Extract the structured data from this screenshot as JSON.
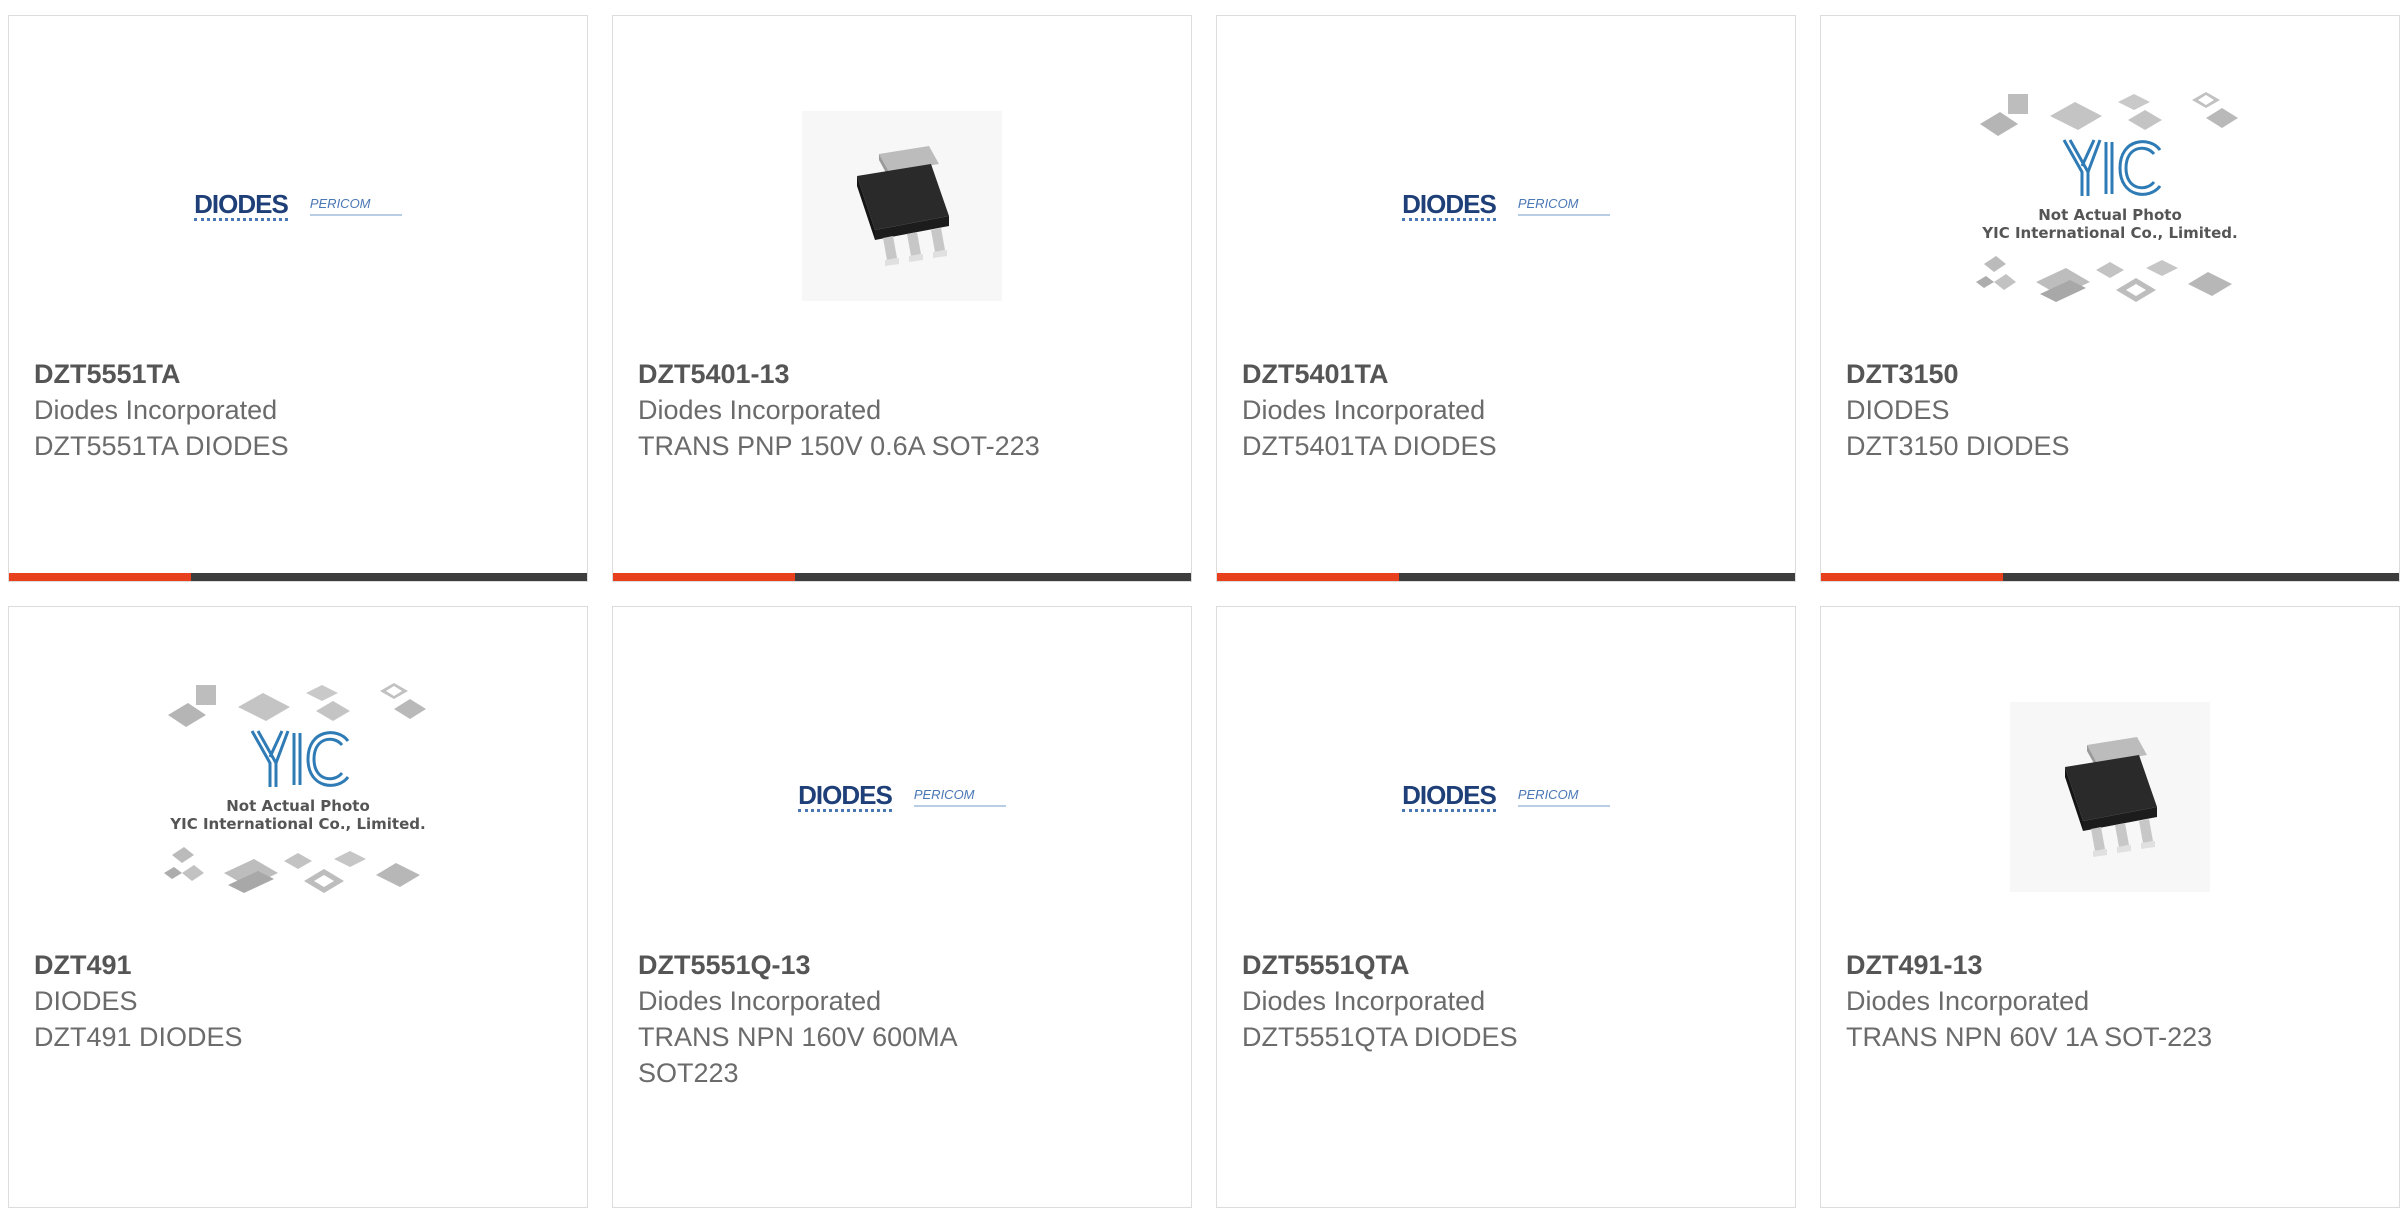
{
  "products": [
    {
      "part": "DZT5551TA",
      "maker": "Diodes Incorporated",
      "desc": "DZT5551TA DIODES",
      "image": "diodes-pericom-logo"
    },
    {
      "part": "DZT5401-13",
      "maker": "Diodes Incorporated",
      "desc": "TRANS PNP 150V 0.6A SOT-223",
      "image": "sot-223-package"
    },
    {
      "part": "DZT5401TA",
      "maker": "Diodes Incorporated",
      "desc": "DZT5401TA DIODES",
      "image": "diodes-pericom-logo"
    },
    {
      "part": "DZT3150",
      "maker": "DIODES",
      "desc": "DZT3150 DIODES",
      "image": "yic-placeholder"
    },
    {
      "part": "DZT491",
      "maker": "DIODES",
      "desc": "DZT491 DIODES",
      "image": "yic-placeholder"
    },
    {
      "part": "DZT5551Q-13",
      "maker": "Diodes Incorporated",
      "desc": "TRANS NPN 160V 600MA SOT223",
      "image": "diodes-pericom-logo"
    },
    {
      "part": "DZT5551QTA",
      "maker": "Diodes Incorporated",
      "desc": "DZT5551QTA DIODES",
      "image": "diodes-pericom-logo"
    },
    {
      "part": "DZT491-13",
      "maker": "Diodes Incorporated",
      "desc": "TRANS NPN 60V 1A SOT-223",
      "image": "sot-223-package"
    }
  ],
  "logo_text": {
    "diodes": "DIODES",
    "pericom": "PERICOM"
  },
  "yic_text": {
    "brand": "YIC",
    "line1": "Not Actual Photo",
    "line2": "YIC International Co., Limited."
  },
  "colors": {
    "accent": "#e8401c",
    "bar": "#3d3d3d",
    "text": "#6b6b6b",
    "diodes_blue": "#1f3f78"
  }
}
